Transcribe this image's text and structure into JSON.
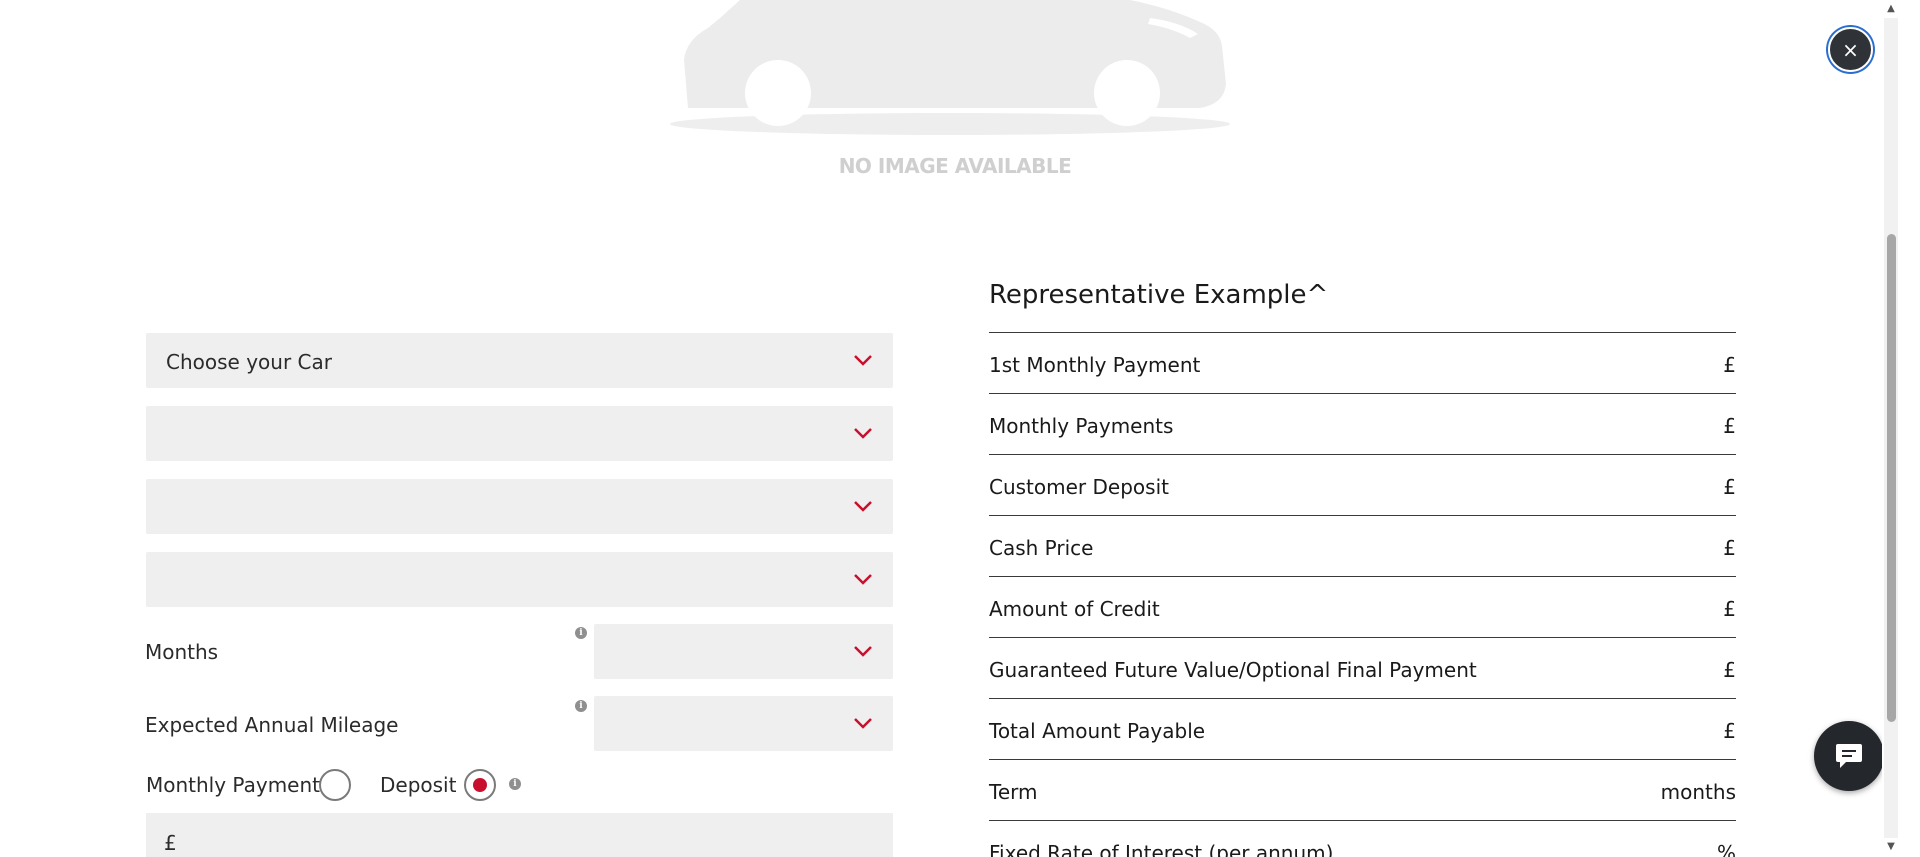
{
  "image": {
    "placeholder_text": "NO IMAGE AVAILABLE"
  },
  "close_button": {
    "glyph": "×"
  },
  "form": {
    "selects": [
      {
        "label": "Choose your Car"
      },
      {
        "label": ""
      },
      {
        "label": ""
      },
      {
        "label": ""
      }
    ],
    "months_label": "Months",
    "mileage_label": "Expected Annual Mileage",
    "radio_monthly_label": "Monthly Payment",
    "radio_deposit_label": "Deposit",
    "radio_selected": "Deposit",
    "amount_currency": "£"
  },
  "representative": {
    "title": "Representative Example^",
    "rows": [
      {
        "label": "1st Monthly Payment",
        "value": "£"
      },
      {
        "label": "Monthly Payments",
        "value": "£"
      },
      {
        "label": "Customer Deposit",
        "value": "£"
      },
      {
        "label": "Cash Price",
        "value": "£"
      },
      {
        "label": "Amount of Credit",
        "value": "£"
      },
      {
        "label": "Guaranteed Future Value/Optional Final Payment",
        "value": "£"
      },
      {
        "label": "Total Amount Payable",
        "value": "£"
      },
      {
        "label": "Term",
        "value": "months"
      },
      {
        "label": "Fixed Rate of Interest (per annum)",
        "value": "%"
      }
    ]
  },
  "colors": {
    "accent_red": "#c8102e",
    "field_bg": "#efefef",
    "dark_button": "#24272b",
    "placeholder_grey": "#cfcfcf"
  },
  "icons": {
    "close": "close-icon",
    "chevron": "chevron-down-icon",
    "info": "info-icon",
    "chat": "chat-icon",
    "car": "car-silhouette-icon"
  }
}
